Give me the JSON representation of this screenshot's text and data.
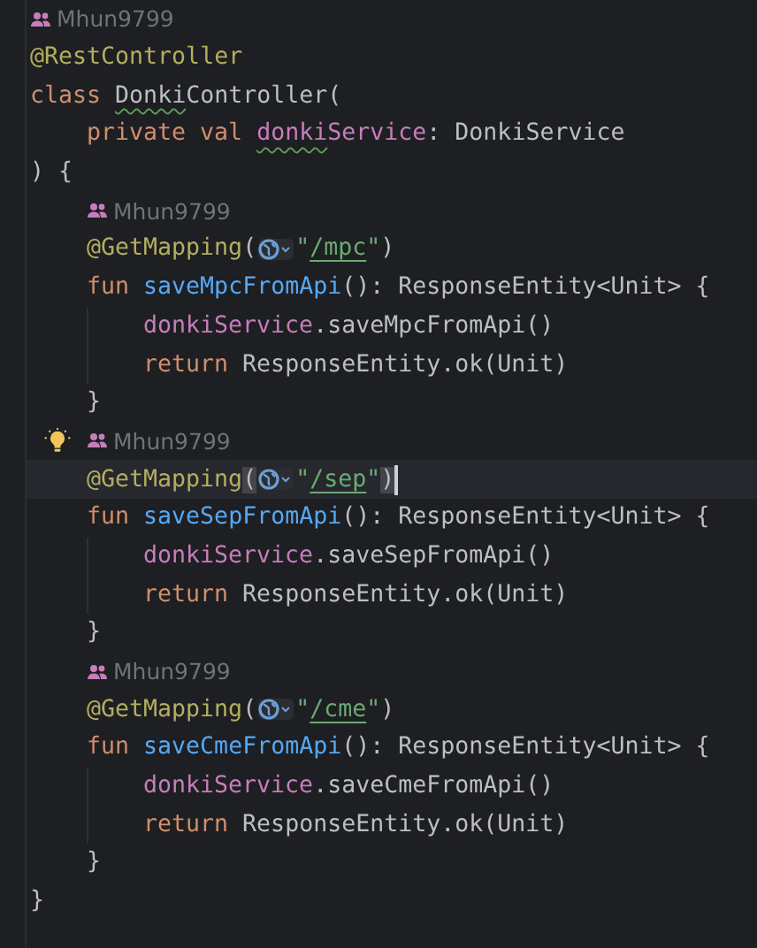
{
  "lines": [
    {
      "kind": "author",
      "text": "Mhun9799"
    },
    {
      "kind": "code",
      "current": false,
      "tokens": [
        {
          "text": "@RestController",
          "kind": "annotation"
        }
      ]
    },
    {
      "kind": "code",
      "current": false,
      "tokens": [
        {
          "text": "class ",
          "kind": "keyword"
        },
        {
          "text": "Donki",
          "kind": "plain",
          "typo": true
        },
        {
          "text": "Controller(",
          "kind": "plain"
        }
      ],
      "children": [
        {
          "kind": "code",
          "current": false,
          "tokens": [
            {
              "text": "private val ",
              "kind": "keyword"
            },
            {
              "text": "donki",
              "kind": "property",
              "typo": true
            },
            {
              "text": "Service",
              "kind": "property"
            },
            {
              "text": ": DonkiService",
              "kind": "plain"
            }
          ]
        }
      ]
    },
    {
      "kind": "code",
      "current": false,
      "tokens": [
        {
          "text": ") {",
          "kind": "plain"
        }
      ],
      "children": [
        {
          "kind": "author",
          "text": "Mhun9799"
        },
        {
          "kind": "code",
          "current": false,
          "tokens": [
            {
              "text": "@GetMapping",
              "kind": "annotation"
            },
            {
              "text": "(",
              "kind": "plain"
            },
            {
              "text": "\"",
              "kind": "string",
              "hint": true
            },
            {
              "text": "/mpc",
              "kind": "string",
              "link": true
            },
            {
              "text": "\"",
              "kind": "string"
            },
            {
              "text": ")",
              "kind": "plain"
            }
          ]
        },
        {
          "kind": "code",
          "current": false,
          "tokens": [
            {
              "text": "fun ",
              "kind": "keyword"
            },
            {
              "text": "saveMpcFromApi",
              "kind": "function"
            },
            {
              "text": "(): ResponseEntity<Unit> {",
              "kind": "plain"
            }
          ],
          "children": [
            {
              "kind": "code",
              "current": false,
              "tokens": [
                {
                  "text": "donkiService",
                  "kind": "property"
                },
                {
                  "text": ".saveMpcFromApi()",
                  "kind": "plain"
                }
              ]
            },
            {
              "kind": "code",
              "current": false,
              "tokens": [
                {
                  "text": "return ",
                  "kind": "keyword"
                },
                {
                  "text": "ResponseEntity.ok(Unit)",
                  "kind": "plain"
                }
              ]
            }
          ]
        },
        {
          "kind": "code",
          "current": false,
          "tokens": [
            {
              "text": "}",
              "kind": "plain"
            }
          ]
        },
        {
          "kind": "author",
          "text": "Mhun9799",
          "bulb": true
        },
        {
          "kind": "code",
          "current": true,
          "tokens": [
            {
              "text": "@GetMapping",
              "kind": "annotation"
            },
            {
              "text": "(",
              "kind": "plain",
              "matched": true
            },
            {
              "text": "\"",
              "kind": "string",
              "hint": true
            },
            {
              "text": "/sep",
              "kind": "string",
              "link": true
            },
            {
              "text": "\"",
              "kind": "string"
            },
            {
              "text": ")",
              "kind": "plain",
              "matched": true
            }
          ]
        },
        {
          "kind": "code",
          "current": false,
          "tokens": [
            {
              "text": "fun ",
              "kind": "keyword"
            },
            {
              "text": "saveSepFromApi",
              "kind": "function"
            },
            {
              "text": "(): ResponseEntity<Unit> {",
              "kind": "plain"
            }
          ],
          "children": [
            {
              "kind": "code",
              "current": false,
              "tokens": [
                {
                  "text": "donkiService",
                  "kind": "property"
                },
                {
                  "text": ".saveSepFromApi()",
                  "kind": "plain"
                }
              ]
            },
            {
              "kind": "code",
              "current": false,
              "tokens": [
                {
                  "text": "return ",
                  "kind": "keyword"
                },
                {
                  "text": "ResponseEntity.ok(Unit)",
                  "kind": "plain"
                }
              ]
            }
          ]
        },
        {
          "kind": "code",
          "current": false,
          "tokens": [
            {
              "text": "}",
              "kind": "plain"
            }
          ]
        },
        {
          "kind": "author",
          "text": "Mhun9799"
        },
        {
          "kind": "code",
          "current": false,
          "tokens": [
            {
              "text": "@GetMapping",
              "kind": "annotation"
            },
            {
              "text": "(",
              "kind": "plain"
            },
            {
              "text": "\"",
              "kind": "string",
              "hint": true
            },
            {
              "text": "/cme",
              "kind": "string",
              "link": true
            },
            {
              "text": "\"",
              "kind": "string"
            },
            {
              "text": ")",
              "kind": "plain"
            }
          ]
        },
        {
          "kind": "code",
          "current": false,
          "tokens": [
            {
              "text": "fun ",
              "kind": "keyword"
            },
            {
              "text": "saveCmeFromApi",
              "kind": "function"
            },
            {
              "text": "(): ResponseEntity<Unit> {",
              "kind": "plain"
            }
          ],
          "children": [
            {
              "kind": "code",
              "current": false,
              "tokens": [
                {
                  "text": "donkiService",
                  "kind": "property"
                },
                {
                  "text": ".saveCmeFromApi()",
                  "kind": "plain"
                }
              ]
            },
            {
              "kind": "code",
              "current": false,
              "tokens": [
                {
                  "text": "return ",
                  "kind": "keyword"
                },
                {
                  "text": "ResponseEntity.ok(Unit)",
                  "kind": "plain"
                }
              ]
            }
          ]
        },
        {
          "kind": "code",
          "current": false,
          "tokens": [
            {
              "text": "}",
              "kind": "plain"
            }
          ]
        }
      ]
    },
    {
      "kind": "code",
      "current": false,
      "tokens": [
        {
          "text": "}",
          "kind": "plain"
        }
      ]
    }
  ]
}
